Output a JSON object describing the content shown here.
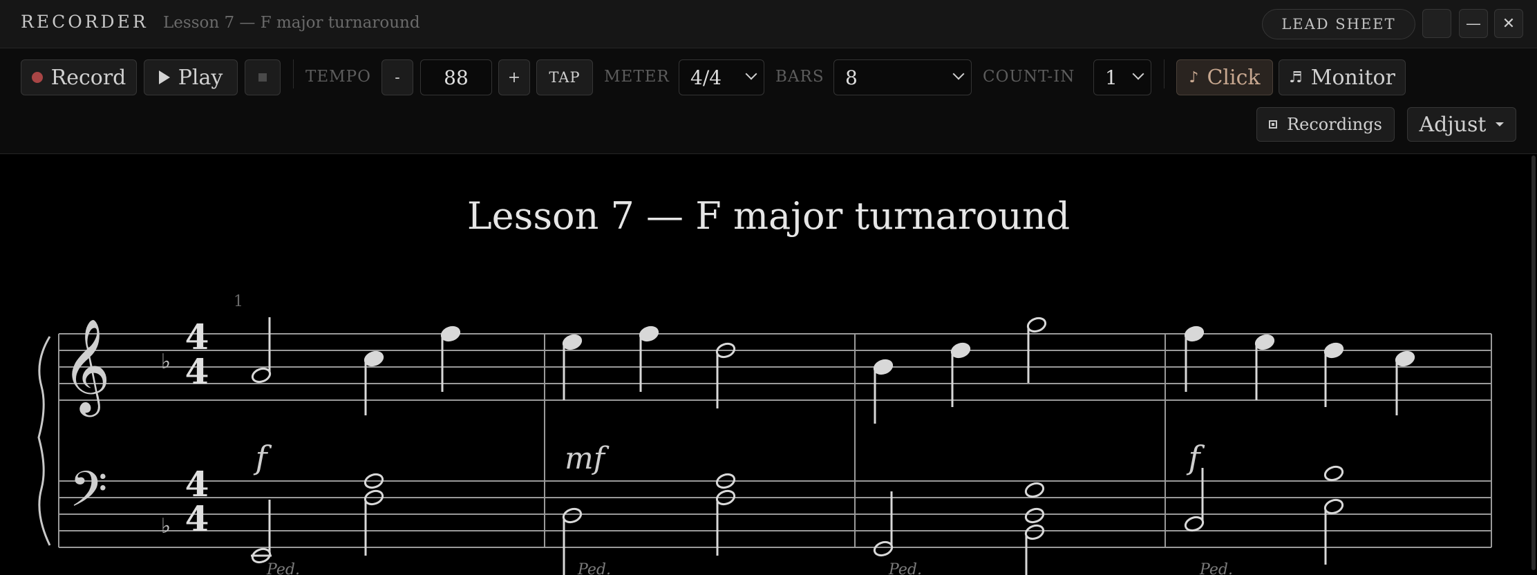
{
  "titlebar": {
    "app_name": "RECORDER",
    "document": "Lesson 7 — F major turnaround",
    "lead_sheet_label": "LEAD SHEET",
    "minimize_glyph": "—",
    "close_glyph": "✕"
  },
  "toolbar": {
    "record_label": "Record",
    "play_label": "Play",
    "tempo_label": "TEMPO",
    "tempo_value": "88",
    "tempo_minus": "-",
    "tempo_plus": "+",
    "tap_label": "TAP",
    "meter_label": "METER",
    "meter_value": "4/4",
    "bars_label": "BARS",
    "bars_value": "8",
    "countin_label": "COUNT-IN",
    "countin_value": "1",
    "click_label": "Click",
    "monitor_label": "Monitor",
    "recordings_label": "Recordings",
    "adjust_label": "Adjust"
  },
  "score": {
    "title": "Lesson 7 — F major turnaround",
    "measure_number": "1",
    "key_signature": "F major (1 flat)",
    "time_signature": {
      "top": "4",
      "bottom": "4"
    },
    "dynamics": [
      "f",
      "mf",
      "f"
    ],
    "pedal_mark": "Ped."
  },
  "colors": {
    "background": "#000000",
    "accent_click": "#c8a890",
    "record_dot": "#a84545"
  },
  "icons": {
    "record": "record-dot-icon",
    "play": "play-icon",
    "stop": "stop-icon",
    "click": "metronome-note-icon",
    "monitor": "headphones-note-icon",
    "recordings": "recordings-square-icon"
  }
}
